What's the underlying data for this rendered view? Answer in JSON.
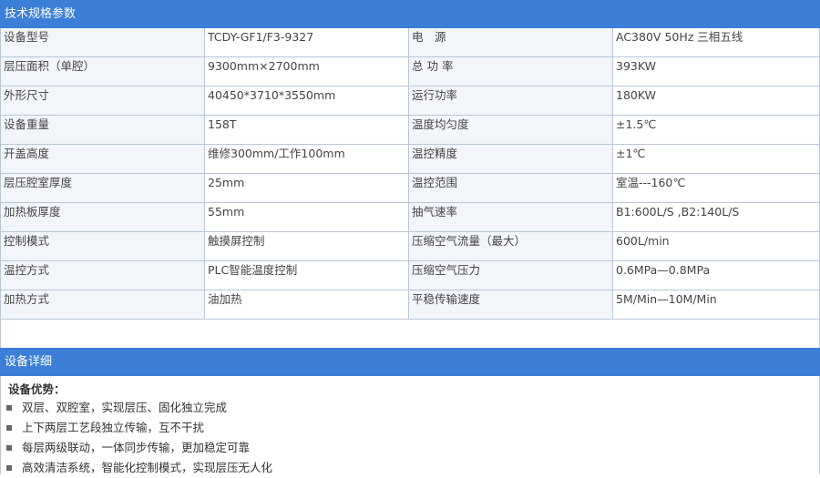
{
  "specs_header": "技术规格参数",
  "rows": [
    {
      "k1": "设备型号",
      "v1": "TCDY-GF1/F3-9327",
      "k2": "电　源",
      "v2": "AC380V 50Hz 三相五线"
    },
    {
      "k1": "层压面积（单腔）",
      "v1": "9300mm×2700mm",
      "k2": "总 功 率",
      "v2": "393KW"
    },
    {
      "k1": "外形尺寸",
      "v1": "40450*3710*3550mm",
      "k2": "运行功率",
      "v2": "180KW"
    },
    {
      "k1": "设备重量",
      "v1": "158T",
      "k2": "温度均匀度",
      "v2": "±1.5℃"
    },
    {
      "k1": "开盖高度",
      "v1": "维修300mm/工作100mm",
      "k2": "温控精度",
      "v2": "±1℃"
    },
    {
      "k1": "层压腔室厚度",
      "v1": "25mm",
      "k2": "温控范围",
      "v2": "室温---160℃"
    },
    {
      "k1": "加热板厚度",
      "v1": "55mm",
      "k2": "抽气速率",
      "v2": "B1:600L/S ,B2:140L/S"
    },
    {
      "k1": "控制模式",
      "v1": "触摸屏控制",
      "k2": "压缩空气流量（最大）",
      "v2": "600L/min"
    },
    {
      "k1": "温控方式",
      "v1": "PLC智能温度控制",
      "k2": "压缩空气压力",
      "v2": "0.6MPa—0.8MPa"
    },
    {
      "k1": "加热方式",
      "v1": "油加热",
      "k2": "平稳传输速度",
      "v2": "5M/Min—10M/Min"
    }
  ],
  "detail_header": "设备详细",
  "advantages_title": "设备优势：",
  "advantages": [
    "双层、双腔室，实现层压、固化独立完成",
    "上下两层工艺段独立传输，互不干扰",
    "每层两级联动，一体同步传输，更加稳定可靠",
    "高效清洁系统，智能化控制模式，实现层压无人化"
  ],
  "colors": {
    "header_bg": "#3b7fd9",
    "border": "#b8c6d6",
    "marker": "#2a8a3a"
  }
}
